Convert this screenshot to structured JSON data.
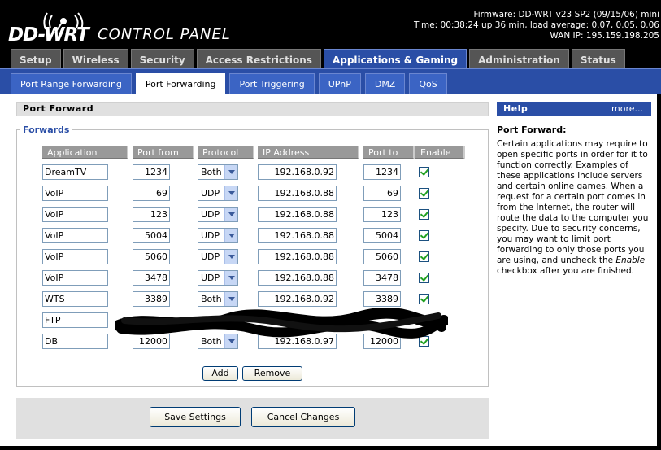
{
  "header": {
    "logo_main": "DD-WRT",
    "logo_sub": "CONTROL PANEL",
    "firmware": "Firmware: DD-WRT v23 SP2 (09/15/06) mini",
    "uptime": "Time: 00:38:24 up 36 min, load average: 0.07, 0.05, 0.06",
    "wan_ip": "WAN IP: 195.159.198.205"
  },
  "main_tabs": [
    {
      "label": "Setup",
      "active": false
    },
    {
      "label": "Wireless",
      "active": false
    },
    {
      "label": "Security",
      "active": false
    },
    {
      "label": "Access Restrictions",
      "active": false
    },
    {
      "label": "Applications & Gaming",
      "active": true
    },
    {
      "label": "Administration",
      "active": false
    },
    {
      "label": "Status",
      "active": false
    }
  ],
  "sub_tabs": [
    {
      "label": "Port Range Forwarding",
      "active": false
    },
    {
      "label": "Port Forwarding",
      "active": true
    },
    {
      "label": "Port Triggering",
      "active": false
    },
    {
      "label": "UPnP",
      "active": false
    },
    {
      "label": "DMZ",
      "active": false
    },
    {
      "label": "QoS",
      "active": false
    }
  ],
  "section_title": "Port Forward",
  "forwards": {
    "legend": "Forwards",
    "columns": [
      "Application",
      "Port from",
      "Protocol",
      "IP Address",
      "Port to",
      "Enable"
    ],
    "rows": [
      {
        "application": "DreamTV",
        "port_from": "1234",
        "protocol": "Both",
        "ip": "192.168.0.92",
        "port_to": "1234",
        "enabled": true,
        "redacted": false
      },
      {
        "application": "VoIP",
        "port_from": "69",
        "protocol": "UDP",
        "ip": "192.168.0.88",
        "port_to": "69",
        "enabled": true,
        "redacted": false
      },
      {
        "application": "VoIP",
        "port_from": "123",
        "protocol": "UDP",
        "ip": "192.168.0.88",
        "port_to": "123",
        "enabled": true,
        "redacted": false
      },
      {
        "application": "VoIP",
        "port_from": "5004",
        "protocol": "UDP",
        "ip": "192.168.0.88",
        "port_to": "5004",
        "enabled": true,
        "redacted": false
      },
      {
        "application": "VoIP",
        "port_from": "5060",
        "protocol": "UDP",
        "ip": "192.168.0.88",
        "port_to": "5060",
        "enabled": true,
        "redacted": false
      },
      {
        "application": "VoIP",
        "port_from": "3478",
        "protocol": "UDP",
        "ip": "192.168.0.88",
        "port_to": "3478",
        "enabled": true,
        "redacted": false
      },
      {
        "application": "WTS",
        "port_from": "3389",
        "protocol": "Both",
        "ip": "192.168.0.92",
        "port_to": "3389",
        "enabled": true,
        "redacted": false
      },
      {
        "application": "FTP",
        "port_from": "",
        "protocol": "",
        "ip": "",
        "port_to": "",
        "enabled": false,
        "redacted": true
      },
      {
        "application": "DB",
        "port_from": "12000",
        "protocol": "Both",
        "ip": "192.168.0.97",
        "port_to": "12000",
        "enabled": true,
        "redacted": false
      }
    ],
    "add_label": "Add",
    "remove_label": "Remove"
  },
  "actions": {
    "save_label": "Save Settings",
    "cancel_label": "Cancel Changes"
  },
  "help": {
    "title": "Help",
    "more_label": "more...",
    "heading": "Port Forward:",
    "text_before": "Certain applications may require to open specific ports in order for it to function correctly. Examples of these applications include servers and certain online games. When a request for a certain port comes in from the Internet, the router will route the data to the computer you specify. Due to security concerns, you may want to limit port forwarding to only those ports you are using, and uncheck the ",
    "text_emphasis": "Enable",
    "text_after": " checkbox after you are finished."
  },
  "colors": {
    "accent": "#2a4ea6",
    "header_bg": "#000000",
    "check_mark": "#21a121"
  }
}
